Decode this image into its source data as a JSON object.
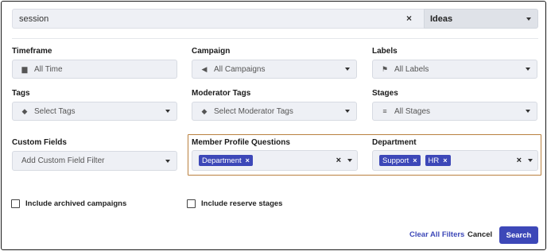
{
  "search": {
    "value": "session",
    "clear_glyph": "×"
  },
  "type_select": {
    "value": "Ideas"
  },
  "filters": {
    "timeframe": {
      "label": "Timeframe",
      "value": "All Time",
      "icon": "calendar-icon"
    },
    "campaign": {
      "label": "Campaign",
      "value": "All Campaigns",
      "icon": "megaphone-icon"
    },
    "labels": {
      "label": "Labels",
      "value": "All Labels",
      "icon": "flag-icon"
    },
    "tags": {
      "label": "Tags",
      "value": "Select Tags",
      "icon": "tag-icon"
    },
    "moderator_tags": {
      "label": "Moderator Tags",
      "value": "Select Moderator Tags",
      "icon": "tag-icon"
    },
    "stages": {
      "label": "Stages",
      "value": "All Stages",
      "icon": "filter-lines-icon"
    },
    "custom_fields": {
      "label": "Custom Fields",
      "placeholder": "Add Custom Field Filter"
    },
    "member_profile_questions": {
      "label": "Member Profile Questions",
      "chips": [
        "Department"
      ]
    },
    "department": {
      "label": "Department",
      "chips": [
        "Support",
        "HR"
      ]
    }
  },
  "checkboxes": {
    "archived": "Include archived campaigns",
    "reserve": "Include reserve stages"
  },
  "actions": {
    "clear_all": "Clear All Filters",
    "cancel": "Cancel",
    "search": "Search"
  },
  "colors": {
    "accent": "#3d48b8",
    "highlight_border": "#b9803f",
    "field_bg": "#eef0f5"
  }
}
